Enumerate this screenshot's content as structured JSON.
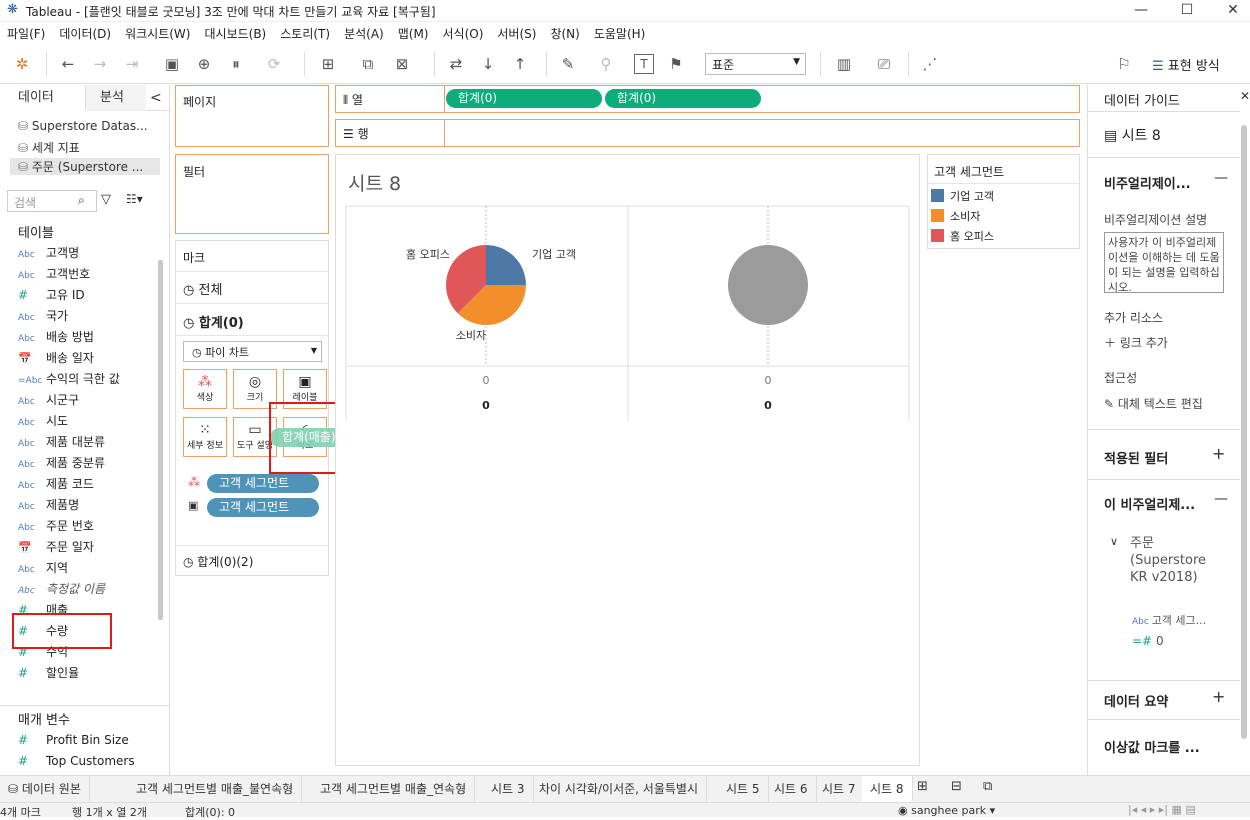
{
  "window": {
    "title": "Tableau - [플랜잇 태블로 굿모닝] 3조 만에 막대 차트 만들기 교육 자료 [복구됨]",
    "min": "—",
    "max": "☐",
    "close": "✕"
  },
  "menu": [
    "파일(F)",
    "데이터(D)",
    "워크시트(W)",
    "대시보드(B)",
    "스토리(T)",
    "분석(A)",
    "맵(M)",
    "서식(O)",
    "서버(S)",
    "창(N)",
    "도움말(H)"
  ],
  "toolbar": {
    "fit": "표준",
    "show_me": "표현 방식"
  },
  "left": {
    "tab_data": "데이터",
    "tab_analysis": "분석",
    "collapse": "<",
    "datasources": [
      "Superstore Datas...",
      "세계 지표",
      "주문 (Superstore ..."
    ],
    "search_placeholder": "검색",
    "tables_heading": "테이블",
    "fields": [
      {
        "type": "Abc",
        "name": "고객 세그먼트"
      },
      {
        "type": "Abc",
        "name": "고객명"
      },
      {
        "type": "Abc",
        "name": "고객번호"
      },
      {
        "type": "#",
        "name": "고유 ID"
      },
      {
        "type": "Abc",
        "name": "국가"
      },
      {
        "type": "Abc",
        "name": "배송 방법"
      },
      {
        "type": "📅",
        "name": "배송 일자"
      },
      {
        "type": "=Abc",
        "name": "수익의 극한 값"
      },
      {
        "type": "Abc",
        "name": "시군구"
      },
      {
        "type": "Abc",
        "name": "시도"
      },
      {
        "type": "Abc",
        "name": "제품 대분류"
      },
      {
        "type": "Abc",
        "name": "제품 중분류"
      },
      {
        "type": "Abc",
        "name": "제품 코드"
      },
      {
        "type": "Abc",
        "name": "제품명"
      },
      {
        "type": "Abc",
        "name": "주문 번호"
      },
      {
        "type": "📅",
        "name": "주문 일자"
      },
      {
        "type": "Abc",
        "name": "지역"
      },
      {
        "type": "Abc",
        "name": "측정값 이름"
      },
      {
        "type": "#",
        "name": "매출"
      },
      {
        "type": "#",
        "name": "수량"
      },
      {
        "type": "#",
        "name": "수익"
      },
      {
        "type": "#",
        "name": "할인율"
      }
    ],
    "params_heading": "매개 변수",
    "params": [
      {
        "type": "#",
        "name": "Profit Bin Size"
      },
      {
        "type": "#",
        "name": "Top Customers"
      }
    ]
  },
  "shelves": {
    "pages": "페이지",
    "filters": "필터",
    "columns": "열",
    "rows": "행",
    "col_pills": [
      "합계(0)",
      "합계(0)"
    ]
  },
  "marks": {
    "title": "마크",
    "all": "전체",
    "current": "합계(0)",
    "type": "파이 차트",
    "buttons": [
      "색상",
      "크기",
      "레이블",
      "세부 정보",
      "도구 설명",
      "각도"
    ],
    "drag_pill": "합계(매출)",
    "pills": [
      "고객 세그먼트",
      "고객 세그먼트"
    ],
    "second": "합계(0)(2)"
  },
  "sheet": {
    "title": "시트 8",
    "zero_labels": [
      "0",
      "0"
    ],
    "zero_values": [
      "0",
      "0"
    ]
  },
  "chart_data": {
    "type": "pie",
    "slices": [
      {
        "label": "기업 고객",
        "value": 0.25,
        "color": "#4e79a7"
      },
      {
        "label": "소비자",
        "value": 0.375,
        "color": "#f28e2b"
      },
      {
        "label": "홈 오피스",
        "value": 0.375,
        "color": "#e15759"
      }
    ],
    "second_pie_color": "#9b9b9b"
  },
  "legend": {
    "title": "고객 세그먼트",
    "items": [
      {
        "label": "기업 고객",
        "color": "#4e79a7"
      },
      {
        "label": "소비자",
        "color": "#f28e2b"
      },
      {
        "label": "홈 오피스",
        "color": "#e15759"
      }
    ]
  },
  "right": {
    "title": "데이터 가이드",
    "close": "✕",
    "sheet": "시트 8",
    "viz": "비주얼리제이...",
    "viz_desc_label": "비주얼리제이션 설명",
    "viz_desc_placeholder": "사용자가 이 비주얼리제이션을 이해하는 데 도움이 되는 설명을 입력하십시오.",
    "resources": "추가 리소스",
    "add_link": "링크 추가",
    "access": "접근성",
    "alt_text": "대체 텍스트 편집",
    "applied_filters": "적용된 필터",
    "this_viz": "이 비주얼리제...",
    "ds_name": "주문 (Superstore KR v2018)",
    "f1": "고객 세그...",
    "f2": "0",
    "summary": "데이터 요약",
    "outliers": "이상값 마크를 ..."
  },
  "bottom_tabs": [
    "데이터 원본",
    "고객 세그먼트별 매출_불연속형",
    "고객 세그먼트별 매출_연속형",
    "시트 3",
    "차이 시각화/이서준, 서울특별시",
    "시트 5",
    "시트 6",
    "시트 7",
    "시트 8"
  ],
  "status": {
    "marks": "4개 마크",
    "rows": "행 1개 x 열 2개",
    "sum": "합계(0): 0",
    "user": "sanghee park"
  }
}
